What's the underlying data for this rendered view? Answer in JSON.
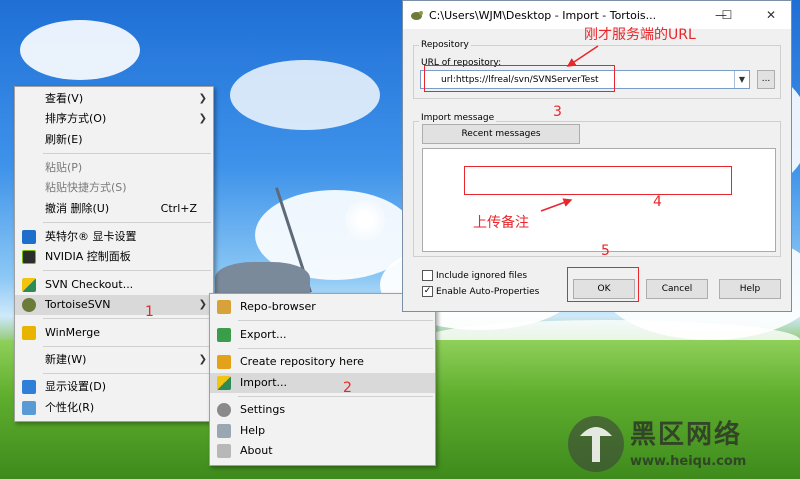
{
  "desktop_menu": {
    "items": [
      {
        "label": "查看(V)",
        "arrow": true
      },
      {
        "label": "排序方式(O)",
        "arrow": true
      },
      {
        "label": "刷新(E)"
      },
      {
        "label": "粘贴(P)",
        "disabled": true
      },
      {
        "label": "粘贴快捷方式(S)",
        "disabled": true
      },
      {
        "label": "撤消 删除(U)",
        "shortcut": "Ctrl+Z"
      },
      {
        "label": "英特尔® 显卡设置",
        "icon": "intel-graphics-icon"
      },
      {
        "label": "NVIDIA 控制面板",
        "icon": "nvidia-icon"
      },
      {
        "label": "SVN Checkout...",
        "icon": "svn-checkout-icon"
      },
      {
        "label": "TortoiseSVN",
        "icon": "tortoisesvn-icon",
        "arrow": true
      },
      {
        "label": "WinMerge",
        "icon": "winmerge-icon"
      },
      {
        "label": "新建(W)",
        "arrow": true
      },
      {
        "label": "显示设置(D)",
        "icon": "display-settings-icon"
      },
      {
        "label": "个性化(R)",
        "icon": "personalize-icon"
      }
    ]
  },
  "svn_submenu": {
    "items": [
      {
        "label": "Repo-browser",
        "icon": "repo-browser-icon"
      },
      {
        "label": "Export...",
        "icon": "export-icon"
      },
      {
        "label": "Create repository here",
        "icon": "create-repo-icon"
      },
      {
        "label": "Import...",
        "icon": "import-icon"
      },
      {
        "label": "Settings",
        "icon": "settings-icon"
      },
      {
        "label": "Help",
        "icon": "help-icon"
      },
      {
        "label": "About",
        "icon": "about-icon"
      }
    ]
  },
  "dialog": {
    "title": "C:\\Users\\WJM\\Desktop - Import - Tortois...",
    "repository_group": "Repository",
    "url_label": "URL of repository:",
    "url_value": "url:https://lfreal/svn/SVNServerTest",
    "browse_label": "...",
    "import_message_group": "Import message",
    "recent_messages_label": "Recent messages",
    "include_ignored_label": "Include ignored files",
    "enable_auto_props_label": "Enable Auto-Properties",
    "include_ignored_checked": false,
    "enable_auto_props_checked": true,
    "ok_label": "OK",
    "cancel_label": "Cancel",
    "help_label": "Help",
    "minimize_glyph": "—",
    "maximize_glyph": "☐",
    "close_glyph": "✕"
  },
  "annotations": {
    "n1": "1",
    "n2": "2",
    "n3": "3",
    "n4": "4",
    "n5": "5",
    "url_note": "刚才服务端的URL",
    "msg_note": "上传备注"
  },
  "watermark": {
    "text": "黑区网络",
    "url": "www.heiqu.com"
  },
  "colors": {
    "annotation_red": "#e8262b",
    "menu_bg": "#f2f2f2",
    "dialog_bg": "#f0f0f0"
  }
}
